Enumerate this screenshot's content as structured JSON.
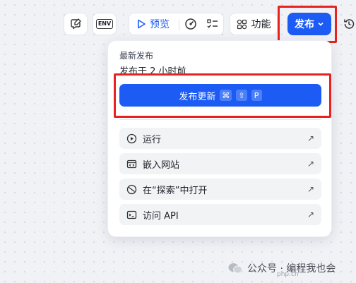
{
  "toolbar": {
    "env_label": "ENV",
    "preview_label": "预览",
    "features_label": "功能",
    "publish_label": "发布"
  },
  "publish_panel": {
    "title": "最新发布",
    "subtitle": "发布于 2 小时前",
    "update_button": {
      "label": "发布更新",
      "shortcut_keys": [
        "⌘",
        "⇧",
        "P"
      ]
    },
    "items": [
      {
        "label": "运行",
        "icon": "play-circle-icon"
      },
      {
        "label": "嵌入网站",
        "icon": "embed-window-icon"
      },
      {
        "label": "在“探索”中打开",
        "icon": "compass-icon"
      },
      {
        "label": "访问 API",
        "icon": "terminal-icon"
      }
    ]
  },
  "watermark": {
    "text": "公众号 · 编程我也会",
    "small_text": "php.cn"
  },
  "colors": {
    "accent": "#1c5cf5",
    "highlight_box": "#e8231f"
  }
}
